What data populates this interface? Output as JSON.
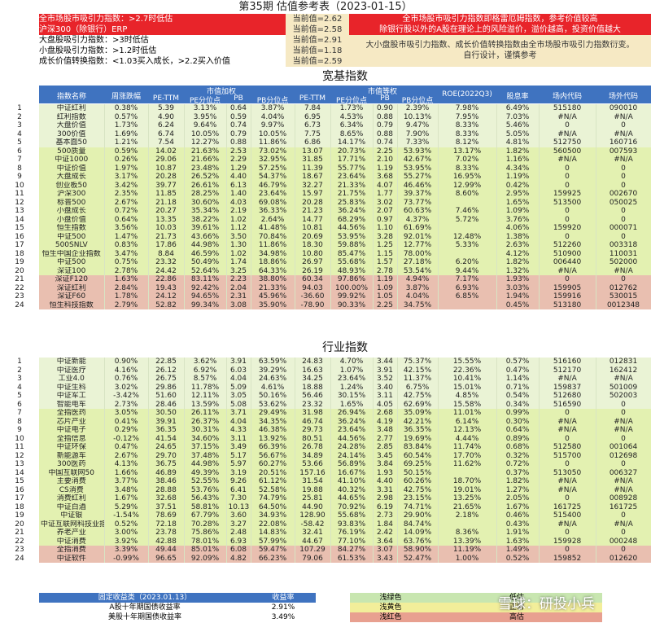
{
  "title": "第35期  估值参考表（2023-01-15）",
  "header": {
    "erp_label": "全市场股市吸引力指数：>2.7时低估",
    "hs300_label": "沪深300（除银行）ERP",
    "big_label": "大盘股吸引力指数：>3时低估",
    "small_label": "小盘股吸引力指数：>1.2时低估",
    "growth_label": "成长价值转换指数：<1.03买入成长，>2.2买入价值",
    "values": [
      "当前值=2.62",
      "当前值=2.58",
      "当前值=2.91",
      "当前值=1.18",
      "当前值=2.59"
    ],
    "note_red_1": "全市场股市吸引力指数即格雷厄姆指数，参考价值较高",
    "note_red_2": "除银行股以外的A股在理论上的风险溢价，溢价越高，投资价值越大",
    "note_yel_1": "大小盘股市吸引力指数、成长价值转换指数由全市场股市吸引力指数衍变。",
    "note_yel_2": "自行设计，谨慎参考"
  },
  "section1": "宽基指数",
  "section2": "行业指数",
  "columns": {
    "name": "指数名称",
    "change": "周涨跌幅",
    "mktcap": "市值加权",
    "equal": "市值等权",
    "pe": "PE-TTM",
    "pe_pct": "PE分位点",
    "pb": "PB",
    "pb_pct": "PB分位点",
    "roe": "ROE(2022Q3)",
    "div": "股息率",
    "code_in": "场内代码",
    "code_out": "场外代码"
  },
  "broad": [
    [
      "中证红利",
      "0.38%",
      "5.39",
      "3.13%",
      "0.64",
      "3.87%",
      "7.84",
      "1.73%",
      "0.90",
      "2.39%",
      "7.98%",
      "6.49%",
      "515180",
      "090010"
    ],
    [
      "红利指数",
      "0.57%",
      "4.90",
      "3.95%",
      "0.59",
      "4.04%",
      "6.95",
      "4.53%",
      "0.88",
      "10.13%",
      "7.95%",
      "7.03%",
      "#N/A",
      "#N/A"
    ],
    [
      "大盘价值",
      "1.73%",
      "6.24",
      "9.64%",
      "0.74",
      "9.97%",
      "6.73",
      "6.34%",
      "0.79",
      "9.47%",
      "8.33%",
      "5.46%",
      "0",
      "0"
    ],
    [
      "300价值",
      "1.69%",
      "6.74",
      "10.05%",
      "0.79",
      "10.05%",
      "7.75",
      "8.65%",
      "0.88",
      "7.90%",
      "8.33%",
      "5.05%",
      "#N/A",
      "#N/A"
    ],
    [
      "基本面50",
      "1.21%",
      "7.54",
      "12.27%",
      "0.88",
      "11.86%",
      "6.86",
      "14.17%",
      "0.74",
      "7.33%",
      "8.12%",
      "4.81%",
      "512750",
      "160716"
    ],
    [
      "500质量",
      "0.59%",
      "14.02",
      "21.63%",
      "2.53",
      "73.02%",
      "13.07",
      "20.73%",
      "2.25",
      "53.93%",
      "13.17%",
      "1.82%",
      "560500",
      "007593"
    ],
    [
      "中证1000",
      "0.26%",
      "29.06",
      "21.66%",
      "2.29",
      "32.95%",
      "31.85",
      "17.71%",
      "2.10",
      "42.67%",
      "7.02%",
      "1.16%",
      "#N/A",
      "#N/A"
    ],
    [
      "中证价值",
      "1.97%",
      "10.87",
      "23.48%",
      "1.29",
      "57.25%",
      "11.39",
      "55.77%",
      "1.19",
      "53.95%",
      "8.33%",
      "4.34%",
      "0",
      "0"
    ],
    [
      "大盘成长",
      "3.17%",
      "20.28",
      "26.52%",
      "4.40",
      "54.37%",
      "18.67",
      "23.64%",
      "3.68",
      "55.27%",
      "16.95%",
      "1.19%",
      "0",
      "0"
    ],
    [
      "创业板50",
      "3.42%",
      "39.77",
      "26.61%",
      "6.13",
      "46.79%",
      "32.27",
      "21.33%",
      "4.07",
      "46.46%",
      "12.99%",
      "0.42%",
      "0",
      "0"
    ],
    [
      "沪深300",
      "2.35%",
      "11.85",
      "28.25%",
      "1.40",
      "23.64%",
      "15.97",
      "21.75%",
      "1.77",
      "39.37%",
      "8.60%",
      "2.95%",
      "159925",
      "002670"
    ],
    [
      "标普500",
      "2.67%",
      "21.18",
      "30.60%",
      "4.03",
      "69.08%",
      "20.28",
      "25.83%",
      "3.02",
      "73.77%",
      "",
      "1.65%",
      "513500",
      "050025"
    ],
    [
      "小盘成长",
      "0.72%",
      "20.27",
      "35.34%",
      "2.19",
      "36.33%",
      "21.23",
      "36.24%",
      "2.07",
      "60.63%",
      "7.46%",
      "1.09%",
      "0",
      "0"
    ],
    [
      "小盘价值",
      "0.64%",
      "13.35",
      "38.22%",
      "1.02",
      "2.64%",
      "14.77",
      "68.29%",
      "0.97",
      "4.37%",
      "5.72%",
      "3.76%",
      "0",
      "0"
    ],
    [
      "恒生指数",
      "3.56%",
      "10.03",
      "39.61%",
      "1.12",
      "41.48%",
      "10.81",
      "44.56%",
      "1.10",
      "61.69%",
      "",
      "4.06%",
      "159920",
      "000071"
    ],
    [
      "中证500",
      "1.47%",
      "21.73",
      "43.66%",
      "3.50",
      "70.84%",
      "20.69",
      "53.95%",
      "3.28",
      "92.01%",
      "12.48%",
      "1.38%",
      "0",
      "0"
    ],
    [
      "500SNLV",
      "0.83%",
      "17.86",
      "44.98%",
      "1.30",
      "11.86%",
      "18.30",
      "59.88%",
      "1.25",
      "12.77%",
      "5.33%",
      "2.63%",
      "512260",
      "003318"
    ],
    [
      "恒生中国企业指数",
      "3.47%",
      "8.84",
      "46.59%",
      "1.02",
      "34.98%",
      "10.80",
      "85.47%",
      "1.15",
      "78.00%",
      "",
      "4.12%",
      "510900",
      "110031"
    ],
    [
      "中证500",
      "0.75%",
      "23.32",
      "50.49%",
      "1.74",
      "18.86%",
      "26.97",
      "55.68%",
      "1.57",
      "27.18%",
      "6.20%",
      "1.82%",
      "006440",
      "502000"
    ],
    [
      "深证100",
      "2.78%",
      "24.42",
      "52.64%",
      "3.25",
      "64.33%",
      "26.19",
      "48.93%",
      "2.78",
      "53.54%",
      "9.44%",
      "1.32%",
      "#N/A",
      "#N/A"
    ],
    [
      "深证F120",
      "1.63%",
      "22.86",
      "83.11%",
      "2.23",
      "38.80%",
      "60.34",
      "97.86%",
      "1.19",
      "4.94%",
      "7.17%",
      "1.93%",
      "0",
      "0"
    ],
    [
      "深证红利",
      "2.84%",
      "19.43",
      "92.42%",
      "2.04",
      "21.33%",
      "94.03",
      "100.00%",
      "1.09",
      "3.87%",
      "6.93%",
      "3.03%",
      "159905",
      "012762"
    ],
    [
      "深证F60",
      "1.78%",
      "24.12",
      "94.65%",
      "2.31",
      "45.96%",
      "-36.60",
      "99.92%",
      "1.05",
      "4.04%",
      "6.85%",
      "1.94%",
      "159916",
      "530015"
    ],
    [
      "恒生科技指数",
      "2.79%",
      "52.82",
      "99.34%",
      "3.08",
      "35.90%",
      "-78.90",
      "90.33%",
      "2.25",
      "34.75%",
      "",
      "0.45%",
      "513180",
      "0012348"
    ]
  ],
  "industry": [
    [
      "中证新能",
      "0.90%",
      "22.85",
      "3.62%",
      "3.91",
      "63.59%",
      "24.83",
      "4.70%",
      "3.44",
      "75.37%",
      "15.55%",
      "0.57%",
      "516160",
      "012831"
    ],
    [
      "中证医疗",
      "4.16%",
      "26.12",
      "6.92%",
      "6.03",
      "39.29%",
      "16.63",
      "1.07%",
      "3.91",
      "42.15%",
      "22.36%",
      "0.47%",
      "512170",
      "162412"
    ],
    [
      "工业4.0",
      "0.76%",
      "26.75",
      "8.57%",
      "4.04",
      "24.63%",
      "34.25",
      "23.64%",
      "3.52",
      "11.37%",
      "10.41%",
      "1.14%",
      "#N/A",
      "#N/A"
    ],
    [
      "中证生科",
      "3.02%",
      "29.86",
      "11.78%",
      "5.09",
      "4.61%",
      "18.88",
      "1.24%",
      "3.40",
      "6.75%",
      "15.01%",
      "0.71%",
      "159837",
      "501009"
    ],
    [
      "中证军工",
      "-3.42%",
      "51.60",
      "12.11%",
      "3.05",
      "50.16%",
      "56.46",
      "30.15%",
      "3.11",
      "42.75%",
      "4.85%",
      "0.54%",
      "512680",
      "502003"
    ],
    [
      "智能电车",
      "2.73%",
      "28.46",
      "13.59%",
      "5.08",
      "53.62%",
      "23.32",
      "1.65%",
      "4.05",
      "62.69%",
      "15.58%",
      "0.34%",
      "516590",
      "0"
    ],
    [
      "全指医药",
      "3.05%",
      "30.50",
      "26.11%",
      "3.71",
      "29.49%",
      "31.98",
      "26.94%",
      "2.68",
      "35.09%",
      "11.01%",
      "0.99%",
      "0",
      "0"
    ],
    [
      "芯片产业",
      "0.41%",
      "39.91",
      "26.37%",
      "4.04",
      "34.35%",
      "46.74",
      "36.24%",
      "4.19",
      "42.21%",
      "6.14%",
      "0.30%",
      "#N/A",
      "#N/A"
    ],
    [
      "中证电子",
      "0.29%",
      "36.35",
      "30.31%",
      "4.33",
      "46.38%",
      "29.73",
      "23.64%",
      "3.48",
      "36.35%",
      "12.13%",
      "0.64%",
      "#N/A",
      "#N/A"
    ],
    [
      "全指信息",
      "-0.12%",
      "41.54",
      "34.60%",
      "3.11",
      "13.92%",
      "80.51",
      "44.56%",
      "2.77",
      "19.69%",
      "4.44%",
      "0.89%",
      "0",
      "0"
    ],
    [
      "中证环保",
      "0.47%",
      "24.65",
      "37.15%",
      "3.49",
      "66.39%",
      "26.78",
      "24.28%",
      "2.85",
      "83.84%",
      "11.74%",
      "0.68%",
      "512580",
      "001064"
    ],
    [
      "新能源车",
      "2.67%",
      "29.70",
      "37.48%",
      "5.17",
      "56.67%",
      "34.89",
      "24.14%",
      "3.45",
      "60.54%",
      "17.70%",
      "0.32%",
      "515700",
      "012698"
    ],
    [
      "300医药",
      "4.13%",
      "36.75",
      "44.98%",
      "5.97",
      "60.27%",
      "53.66",
      "56.89%",
      "3.84",
      "69.25%",
      "11.62%",
      "0.72%",
      "0",
      "0"
    ],
    [
      "中国互联网50",
      "1.66%",
      "46.89",
      "49.39%",
      "3.19",
      "20.51%",
      "157.16",
      "16.67%",
      "1.93",
      "50.15%",
      "",
      "0.37%",
      "513050",
      "006327"
    ],
    [
      "主要消费",
      "3.77%",
      "38.46",
      "52.55%",
      "9.26",
      "61.12%",
      "31.54",
      "41.10%",
      "4.40",
      "60.26%",
      "18.70%",
      "1.82%",
      "#N/A",
      "#N/A"
    ],
    [
      "CS消费",
      "3.48%",
      "28.88",
      "53.76%",
      "6.41",
      "52.58%",
      "19.88",
      "40.32%",
      "3.31",
      "42.75%",
      "19.01%",
      "1.27%",
      "#N/A",
      "#N/A"
    ],
    [
      "消费红利",
      "1.67%",
      "32.68",
      "56.43%",
      "7.30",
      "74.79%",
      "25.81",
      "44.65%",
      "2.98",
      "23.15%",
      "13.25%",
      "2.05%",
      "0",
      "008928"
    ],
    [
      "中证白酒",
      "5.29%",
      "37.51",
      "58.81%",
      "10.13",
      "64.50%",
      "44.90",
      "70.92%",
      "6.19",
      "74.71%",
      "21.65%",
      "1.67%",
      "161725",
      "161725"
    ],
    [
      "中证银",
      "-1.54%",
      "78.69",
      "67.79%",
      "3.60",
      "34.93%",
      "128.90",
      "55.68%",
      "2.73",
      "29.90%",
      "2.18%",
      "0.46%",
      "515400",
      "0"
    ],
    [
      "中证互联网科技业指",
      "0.52%",
      "72.18",
      "70.28%",
      "3.27",
      "22.08%",
      "-58.42",
      "93.83%",
      "1.84",
      "84.74%",
      "",
      "0.43%",
      "#N/A",
      "#N/A"
    ],
    [
      "养老产业",
      "3.00%",
      "23.78",
      "75.86%",
      "2.48",
      "14.83%",
      "32.41",
      "76.19%",
      "2.42",
      "14.09%",
      "8.36%",
      "1.91%",
      "0",
      "0"
    ],
    [
      "中证消费",
      "3.92%",
      "42.88",
      "78.01%",
      "6.93",
      "57.99%",
      "44.67",
      "77.10%",
      "3.64",
      "63.76%",
      "13.39%",
      "1.63%",
      "159928",
      "000248"
    ],
    [
      "全指消费",
      "3.39%",
      "49.44",
      "85.01%",
      "6.08",
      "59.47%",
      "107.29",
      "84.27%",
      "3.07",
      "58.90%",
      "11.19%",
      "1.49%",
      "0",
      "0"
    ],
    [
      "中证软件",
      "-0.99%",
      "96.65",
      "92.09%",
      "4.82",
      "66.23%",
      "79.06",
      "61.53%",
      "3.43",
      "52.47%",
      "1.00%",
      "0.52%",
      "159852",
      "012620"
    ]
  ],
  "footer": {
    "fixed_label": "固定收益类（2023.01.13）",
    "yield_label": "收益率",
    "r1": "A股十年期国债收益率",
    "r1v": "2.91%",
    "r2": "美股十年期国债收益率",
    "r2v": "3.49%",
    "leg1": "浅绿色",
    "leg2": "浅黄色",
    "leg3": "浅红色",
    "leg1v": "低估",
    "leg2v": "正常",
    "leg3v": "高估"
  },
  "watermark": "雪球：研投小兵",
  "colors": {
    "red": "#e8242a",
    "blue": "#3f73c0",
    "lightgreen": "#eaf3d5",
    "yellowgreen": "#e3f1b1",
    "pink": "#e9bfb0"
  }
}
